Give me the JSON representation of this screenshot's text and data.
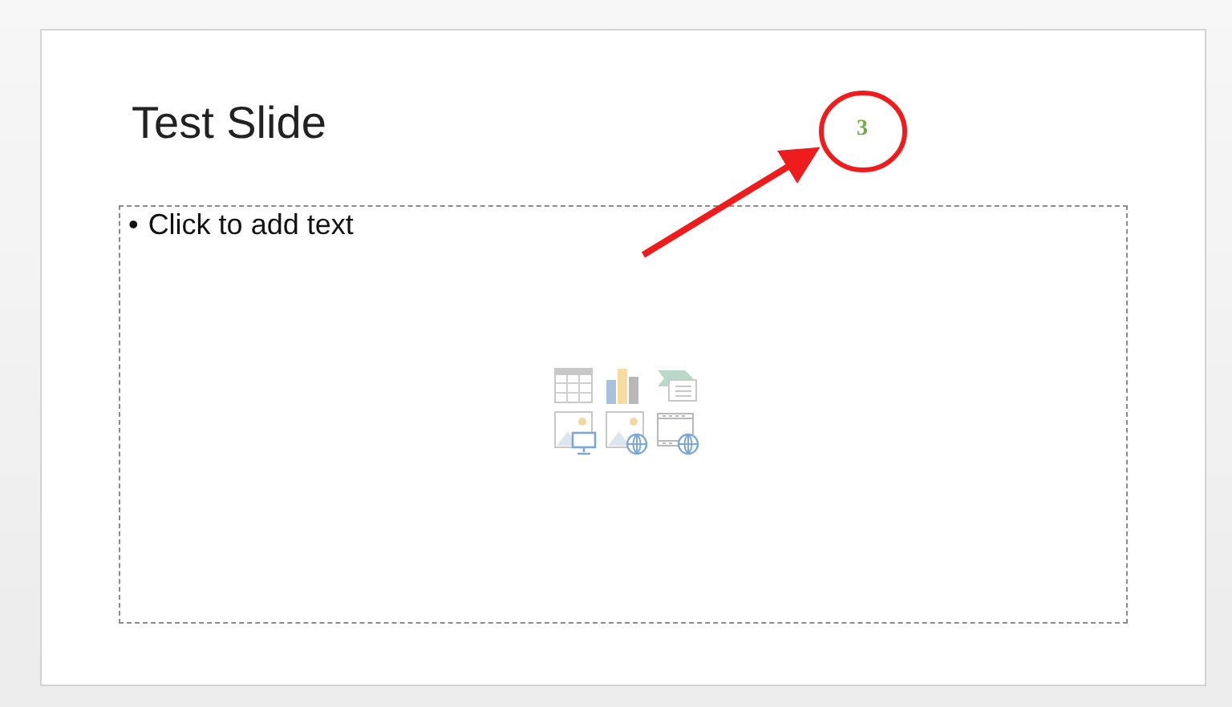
{
  "slide": {
    "title": "Test Slide",
    "body_placeholder": {
      "bullet": "•",
      "text": "Click to add text"
    },
    "slide_number": "3"
  }
}
